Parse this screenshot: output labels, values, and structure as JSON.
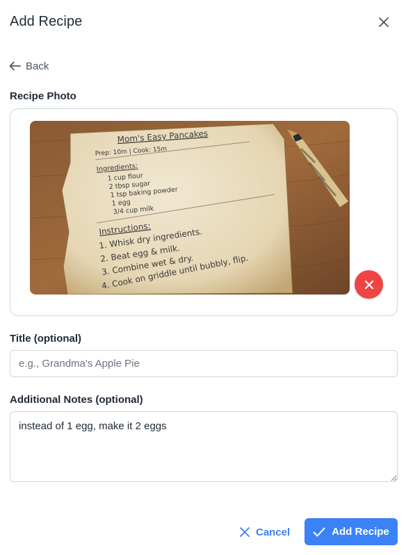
{
  "modal": {
    "title": "Add Recipe"
  },
  "nav": {
    "back_label": "Back"
  },
  "photo_section": {
    "label": "Recipe Photo",
    "image": {
      "heading": "Mom's Easy Pancakes",
      "meta": "Prep: 10m | Cook: 15m",
      "ingredients_title": "Ingredients:",
      "ingredients": [
        "1 cup flour",
        "2 tbsp sugar",
        "1 tsp baking powder",
        "1 egg",
        "3/4 cup milk"
      ],
      "instructions_title": "Instructions:",
      "instructions": [
        "1. Whisk dry ingredients.",
        "2. Beat egg & milk.",
        "3. Combine wet & dry.",
        "4. Cook on griddle until bubbly, flip."
      ]
    }
  },
  "title_field": {
    "label": "Title (optional)",
    "placeholder": "e.g., Grandma's Apple Pie",
    "value": ""
  },
  "notes_field": {
    "label": "Additional Notes (optional)",
    "value": "instead of 1 egg, make it 2 eggs"
  },
  "actions": {
    "cancel_label": "Cancel",
    "add_label": "Add Recipe"
  },
  "colors": {
    "primary": "#3b82f6",
    "danger": "#ef4444",
    "border": "#d1d5db"
  },
  "icons": {
    "close": "close-icon",
    "back": "arrow-left-icon",
    "remove": "x-icon",
    "cancel": "x-icon",
    "add": "check-icon"
  }
}
